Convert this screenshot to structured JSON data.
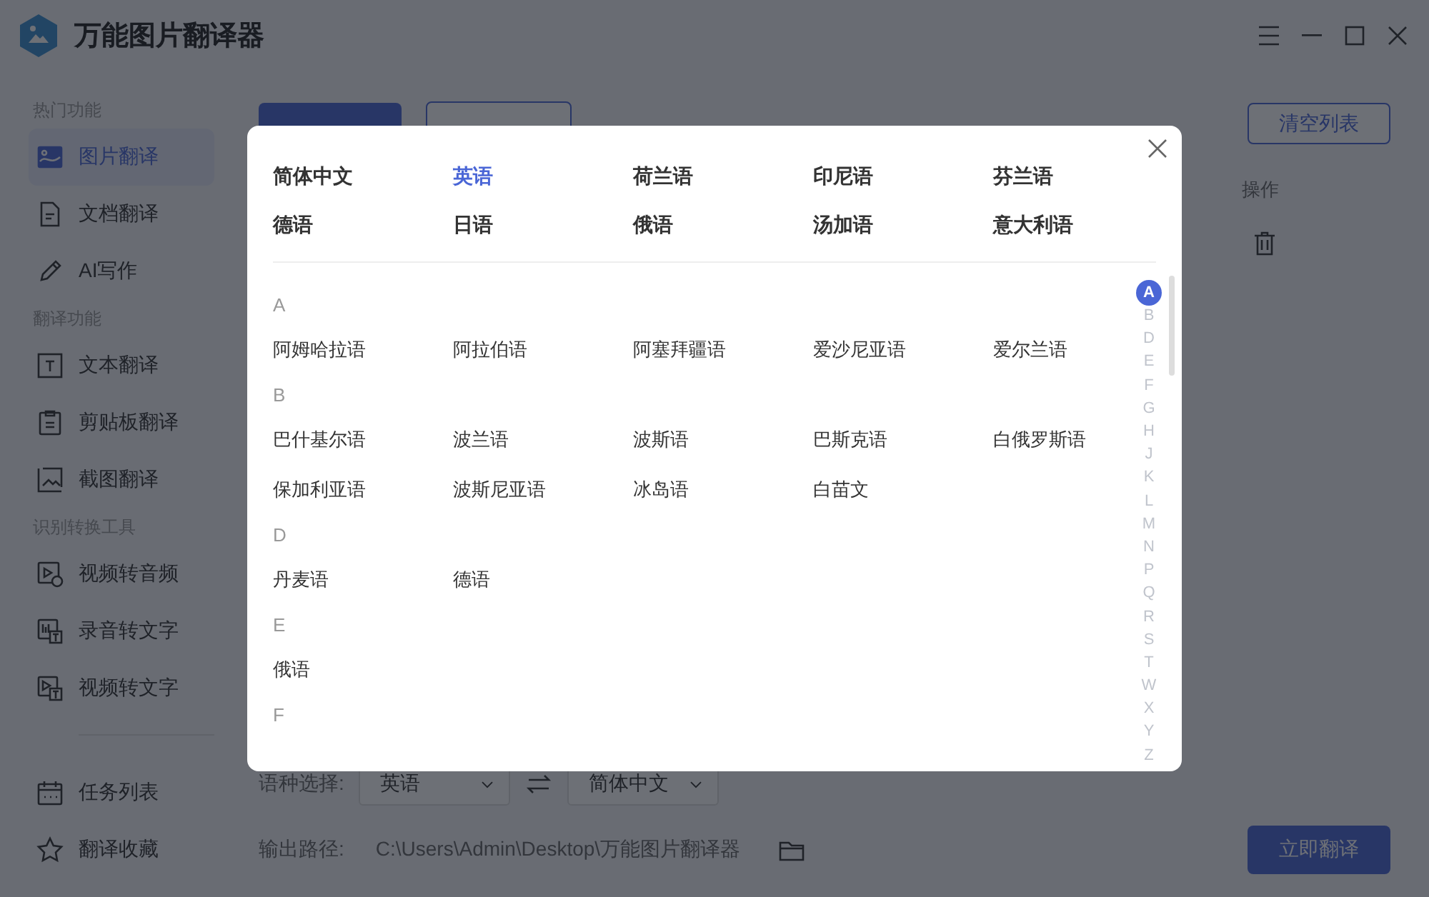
{
  "app": {
    "title": "万能图片翻译器"
  },
  "sidebar": {
    "sections": [
      {
        "heading": "热门功能",
        "items": [
          {
            "label": "图片翻译",
            "selected": true
          },
          {
            "label": "文档翻译",
            "selected": false
          },
          {
            "label": "AI写作",
            "selected": false
          }
        ]
      },
      {
        "heading": "翻译功能",
        "items": [
          {
            "label": "文本翻译",
            "selected": false
          },
          {
            "label": "剪贴板翻译",
            "selected": false
          },
          {
            "label": "截图翻译",
            "selected": false
          }
        ]
      },
      {
        "heading": "识别转换工具",
        "items": [
          {
            "label": "视频转音频",
            "selected": false
          },
          {
            "label": "录音转文字",
            "selected": false
          },
          {
            "label": "视频转文字",
            "selected": false
          }
        ]
      }
    ],
    "bottom_items": [
      {
        "label": "任务列表",
        "selected": false
      },
      {
        "label": "翻译收藏",
        "selected": false
      }
    ]
  },
  "toolbar": {
    "clear_button": "清空列表"
  },
  "table": {
    "columns": [
      "操作"
    ]
  },
  "footer": {
    "language_label": "语种选择:",
    "source_language": "英语",
    "target_language": "简体中文",
    "output_label": "输出路径:",
    "output_path": "C:\\Users\\Admin\\Desktop\\万能图片翻译器",
    "translate_button": "立即翻译"
  },
  "dialog": {
    "popular": [
      {
        "label": "简体中文",
        "selected": false
      },
      {
        "label": "英语",
        "selected": true
      },
      {
        "label": "荷兰语",
        "selected": false
      },
      {
        "label": "印尼语",
        "selected": false
      },
      {
        "label": "芬兰语",
        "selected": false
      },
      {
        "label": "德语",
        "selected": false
      },
      {
        "label": "日语",
        "selected": false
      },
      {
        "label": "俄语",
        "selected": false
      },
      {
        "label": "汤加语",
        "selected": false
      },
      {
        "label": "意大利语",
        "selected": false
      }
    ],
    "groups": [
      {
        "letter": "A",
        "languages": [
          "阿姆哈拉语",
          "阿拉伯语",
          "阿塞拜疆语",
          "爱沙尼亚语",
          "爱尔兰语"
        ]
      },
      {
        "letter": "B",
        "languages": [
          "巴什基尔语",
          "波兰语",
          "波斯语",
          "巴斯克语",
          "白俄罗斯语",
          "保加利亚语",
          "波斯尼亚语",
          "冰岛语",
          "白苗文"
        ]
      },
      {
        "letter": "D",
        "languages": [
          "丹麦语",
          "德语"
        ]
      },
      {
        "letter": "E",
        "languages": [
          "俄语"
        ]
      },
      {
        "letter": "F"
      }
    ],
    "index": [
      {
        "letter": "A",
        "selected": true
      },
      {
        "letter": "B",
        "selected": false
      },
      {
        "letter": "D",
        "selected": false
      },
      {
        "letter": "E",
        "selected": false
      },
      {
        "letter": "F",
        "selected": false
      },
      {
        "letter": "G",
        "selected": false
      },
      {
        "letter": "H",
        "selected": false
      },
      {
        "letter": "J",
        "selected": false
      },
      {
        "letter": "K",
        "selected": false
      },
      {
        "letter": "L",
        "selected": false
      },
      {
        "letter": "M",
        "selected": false
      },
      {
        "letter": "N",
        "selected": false
      },
      {
        "letter": "P",
        "selected": false
      },
      {
        "letter": "Q",
        "selected": false
      },
      {
        "letter": "R",
        "selected": false
      },
      {
        "letter": "S",
        "selected": false
      },
      {
        "letter": "T",
        "selected": false
      },
      {
        "letter": "W",
        "selected": false
      },
      {
        "letter": "X",
        "selected": false
      },
      {
        "letter": "Y",
        "selected": false
      },
      {
        "letter": "Z",
        "selected": false
      }
    ]
  }
}
